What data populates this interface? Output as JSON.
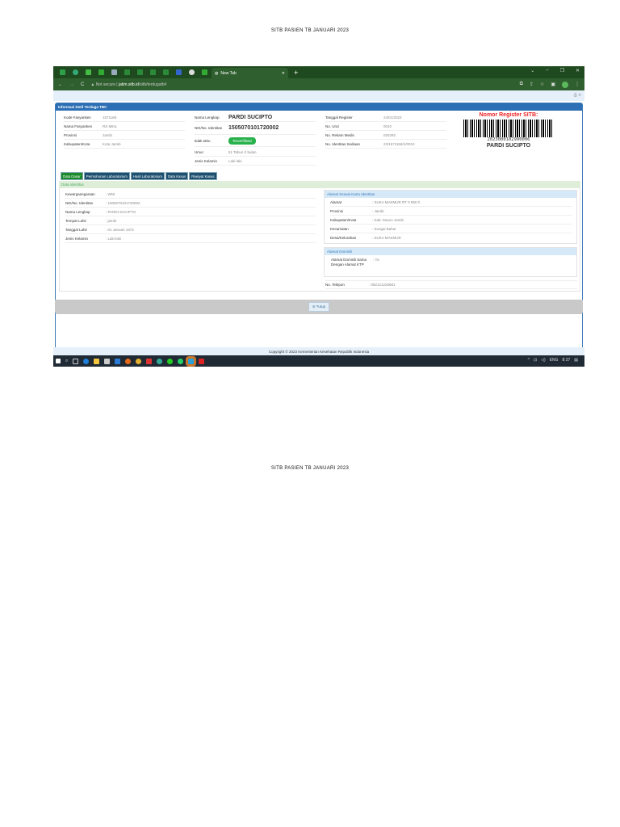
{
  "doc_title": "SITB PASIEN TB JANUARI 2023",
  "browser": {
    "tab_title": "New Tab",
    "url_warning": "Not secure",
    "url_domain": "jatim.sitb.id",
    "url_path": "/sitb/terdugatb#",
    "profile_initial": "I"
  },
  "panel": {
    "title": "Informasi Detil Terduga TBC",
    "left": [
      {
        "label": "Kode Fasyankes",
        "value": "1571168"
      },
      {
        "label": "Nama Fasyankes",
        "value": "RS Mitra"
      },
      {
        "label": "Provinsi",
        "value": "Jambi"
      },
      {
        "label": "Kabupaten/Kota",
        "value": "Kota Jambi"
      }
    ],
    "mid": {
      "nama_label": "Nama Lengkap",
      "nama": "PARDI SUCIPTO",
      "nik_label": "NIK/No. Identitas",
      "nik": "1505070101720002",
      "tidak_tahu_label": "tidak tahu",
      "badge": "Terverifikasi",
      "umur_label": "Umur",
      "umur": "51 Tahun 0 bulan",
      "jk_label": "Jenis Kelamin",
      "jk": "Laki-laki"
    },
    "right": [
      {
        "label": "Tanggal Register",
        "value": "24/01/2023"
      },
      {
        "label": "No. Urut",
        "value": "0010"
      },
      {
        "label": "No. Rekam Medis",
        "value": "025292"
      },
      {
        "label": "No. Identitas Sediaan",
        "value": "23/1571168/1/0010"
      }
    ],
    "register_title": "Nomor Register SITB:",
    "register_number": "2023000102990006",
    "register_name": "PARDI SUCIPTO"
  },
  "tabs": [
    "Data Dasar",
    "Permohonan Laboratorium",
    "Hasil Laboratorium",
    "Data Kasus",
    "Riwayat Kasus"
  ],
  "section_title": "Data Identitas",
  "identitas": [
    {
      "label": "Kewarganegaraan",
      "value": ": WNI"
    },
    {
      "label": "NIK/No. Identitas",
      "value": ": 1505070101720002"
    },
    {
      "label": "Nama Lengkap",
      "value": ": PARDI SUCIPTO"
    },
    {
      "label": "Tempat Lahir",
      "value": ": jambi"
    },
    {
      "label": "Tanggal Lahir",
      "value": ": 01 Januari 1972"
    },
    {
      "label": "Jenis Kelamin",
      "value": ": Laki-laki"
    }
  ],
  "alamat_ktp": {
    "title": "Alamat Sesuai Kartu Identitas",
    "rows": [
      {
        "label": "Alamat",
        "value": ": SUKA MAKMUR RT 0 RW 0"
      },
      {
        "label": "Provinsi",
        "value": ": Jambi"
      },
      {
        "label": "Kabupaten/Kota",
        "value": ": Kab. Muaro Jambi"
      },
      {
        "label": "Kecamatan",
        "value": ": Sungai Bahar"
      },
      {
        "label": "Desa/Kelurahan",
        "value": ": SUKA MAKMUR"
      }
    ]
  },
  "alamat_domisili": {
    "title": "Alamat Domisili",
    "label": "Alamat Domisili Sama Dengan Alamat KTP",
    "value": ": Ya"
  },
  "telepon": {
    "label": "No. Telepon",
    "value": ": 082121220681"
  },
  "close_button": "Tutup",
  "copyright": "Copyright © 2023 Kementerian Kesehatan Republik Indonesia",
  "taskbar": {
    "lang": "ENG",
    "time": "8:37"
  }
}
